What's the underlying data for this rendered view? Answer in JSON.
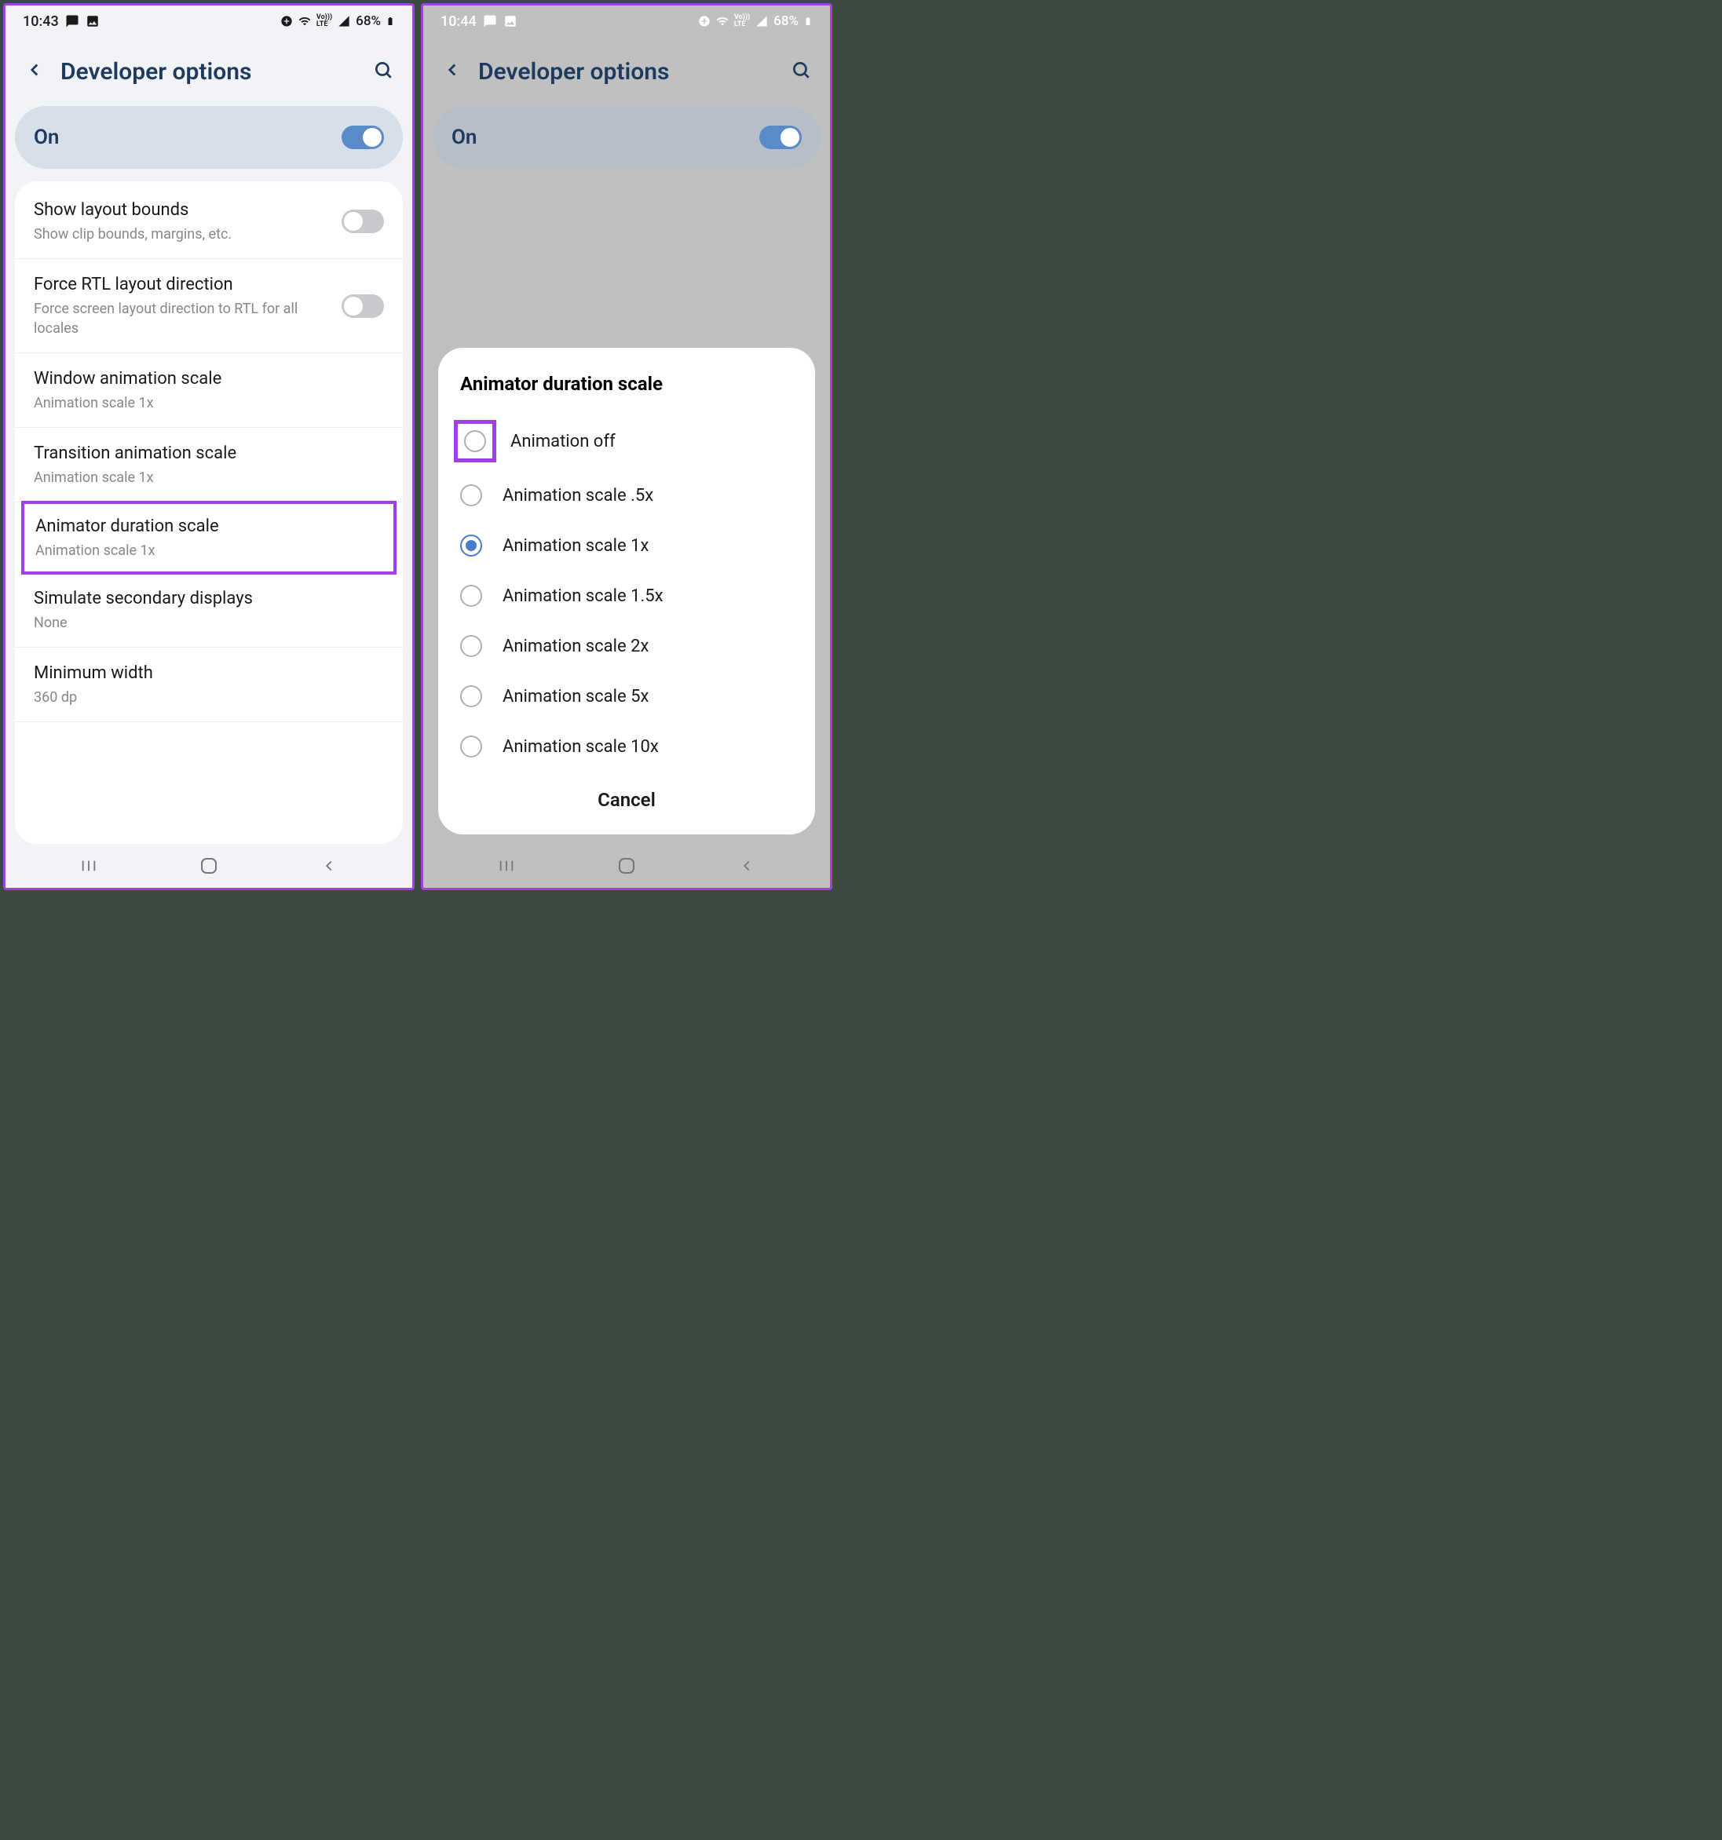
{
  "left": {
    "status": {
      "time": "10:43",
      "battery": "68%"
    },
    "appbar": {
      "title": "Developer options"
    },
    "on": {
      "label": "On"
    },
    "items": [
      {
        "title": "Show layout bounds",
        "sub": "Show clip bounds, margins, etc.",
        "toggle": "off"
      },
      {
        "title": "Force RTL layout direction",
        "sub": "Force screen layout direction to RTL for all locales",
        "toggle": "off"
      },
      {
        "title": "Window animation scale",
        "sub": "Animation scale 1x"
      },
      {
        "title": "Transition animation scale",
        "sub": "Animation scale 1x"
      },
      {
        "title": "Animator duration scale",
        "sub": "Animation scale 1x",
        "highlight": true
      },
      {
        "title": "Simulate secondary displays",
        "sub": "None"
      },
      {
        "title": "Minimum width",
        "sub": "360 dp"
      }
    ]
  },
  "right": {
    "status": {
      "time": "10:44",
      "battery": "68%"
    },
    "appbar": {
      "title": "Developer options"
    },
    "on": {
      "label": "On"
    },
    "dialog": {
      "title": "Animator duration scale",
      "options": [
        {
          "label": "Animation off",
          "highlight": true
        },
        {
          "label": "Animation scale .5x"
        },
        {
          "label": "Animation scale 1x",
          "selected": true
        },
        {
          "label": "Animation scale 1.5x"
        },
        {
          "label": "Animation scale 2x"
        },
        {
          "label": "Animation scale 5x"
        },
        {
          "label": "Animation scale 10x"
        }
      ],
      "cancel": "Cancel"
    }
  }
}
